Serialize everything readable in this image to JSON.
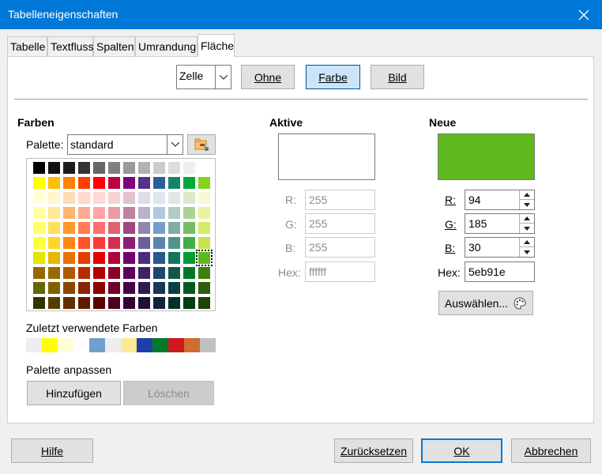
{
  "window": {
    "title": "Tabelleneigenschaften"
  },
  "tabs": [
    {
      "label": "Tabelle"
    },
    {
      "label": "Textfluss"
    },
    {
      "label": "Spalten"
    },
    {
      "label": "Umrandung"
    },
    {
      "label": "Fläche"
    }
  ],
  "fill_type": {
    "combo_value": "Zelle",
    "buttons": [
      "Ohne",
      "Farbe",
      "Bild"
    ],
    "active": "Farbe"
  },
  "colors_section": {
    "heading": "Farben",
    "palette_label": "Palette:",
    "palette_value": "standard",
    "recent_label": "Zuletzt verwendete Farben",
    "customize_label": "Palette anpassen",
    "add_button": "Hinzufügen",
    "delete_button": "Löschen"
  },
  "palette_rows": [
    [
      "#000000",
      "#111111",
      "#1c1c1c",
      "#333333",
      "#666666",
      "#808080",
      "#999999",
      "#b2b2b2",
      "#cccccc",
      "#dddddd",
      "#eeeeee",
      "#ffffff"
    ],
    [
      "#ffff00",
      "#ffbf00",
      "#ff8000",
      "#ff4000",
      "#ff0000",
      "#bf0041",
      "#800080",
      "#55308d",
      "#2a6099",
      "#158466",
      "#00a933",
      "#81d41a"
    ],
    [
      "#ffffd7",
      "#fff5ce",
      "#ffdbb6",
      "#ffd8ce",
      "#ffd7d7",
      "#f7d1d5",
      "#e0c2cd",
      "#dedce6",
      "#dee6ef",
      "#dee7e5",
      "#dde8cb",
      "#f6f9d4"
    ],
    [
      "#ffffa6",
      "#ffe994",
      "#ffb66c",
      "#ffaa95",
      "#ffa6a6",
      "#ec9ba4",
      "#bf819e",
      "#b7b3ca",
      "#b4c7dc",
      "#b3cac7",
      "#afd095",
      "#e8f2a1"
    ],
    [
      "#ffff6d",
      "#ffde59",
      "#ff972f",
      "#ff7b59",
      "#ff6d6d",
      "#e16173",
      "#a1467e",
      "#8e86ae",
      "#729fcf",
      "#81aca6",
      "#77bc65",
      "#d4ea6b"
    ],
    [
      "#ffff38",
      "#ffd428",
      "#ff860d",
      "#ff5429",
      "#ff3838",
      "#d62e4e",
      "#8d1d75",
      "#6b5e9b",
      "#5983b0",
      "#50938a",
      "#3faf46",
      "#c9e14b"
    ],
    [
      "#e6e600",
      "#e6b800",
      "#e67300",
      "#e63d00",
      "#e60000",
      "#b2003a",
      "#730073",
      "#4c2b80",
      "#265a8a",
      "#127660",
      "#009e32",
      "#5eb91e"
    ],
    [
      "#996600",
      "#996a00",
      "#b35900",
      "#b32f00",
      "#b30000",
      "#8c002e",
      "#5c005c",
      "#3d2266",
      "#1f476d",
      "#0e594a",
      "#007a28",
      "#3f7f0d"
    ],
    [
      "#666600",
      "#806000",
      "#8c4600",
      "#8c2600",
      "#8c0000",
      "#70002a",
      "#470047",
      "#2f1a4f",
      "#183754",
      "#0a4039",
      "#005c1e",
      "#2f5d0a"
    ],
    [
      "#333300",
      "#523f00",
      "#5f2f00",
      "#5f1b00",
      "#5f0000",
      "#4d001d",
      "#330033",
      "#1f1133",
      "#102538",
      "#073029",
      "#003d14",
      "#1e4107"
    ]
  ],
  "recent_colors": [
    "#eeeeee",
    "#ffff00",
    "#ffffd7",
    "#ffffff",
    "#729fcf",
    "#eeeeee",
    "#ffe994",
    "#1c3faa",
    "#007a28",
    "#ce181e",
    "#d06b33",
    "#c0c0c0"
  ],
  "active": {
    "heading": "Aktive",
    "preview_color": "#ffffff",
    "r_label": "R:",
    "r_value": "255",
    "g_label": "G:",
    "g_value": "255",
    "b_label": "B:",
    "b_value": "255",
    "hex_label": "Hex:",
    "hex_value": "ffffff"
  },
  "new": {
    "heading": "Neue",
    "preview_color": "#5eb91e",
    "r_label": "R:",
    "r_value": "94",
    "g_label": "G:",
    "g_value": "185",
    "b_label": "B:",
    "b_value": "30",
    "hex_label": "Hex:",
    "hex_value": "5eb91e",
    "pick_button": "Auswählen..."
  },
  "footer": {
    "help": "Hilfe",
    "reset": "Zurücksetzen",
    "ok": "OK",
    "cancel": "Abbrechen"
  }
}
